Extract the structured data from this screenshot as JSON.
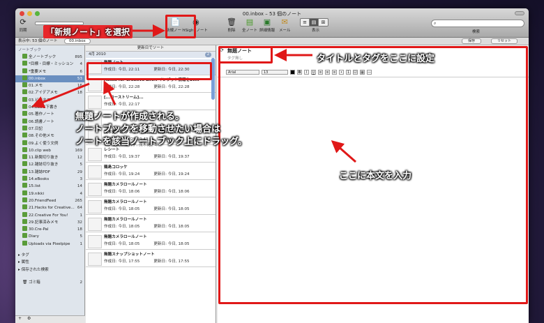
{
  "window": {
    "title": "00.inbox – 53 個のノート"
  },
  "toolbar": {
    "sync_label": "同期",
    "new_note_label": "新規ノート",
    "sight_note_label": "iSight ノート",
    "delete_label": "削除",
    "all_notes_label": "全ノート",
    "info_label": "詳細情報",
    "mail_label": "メール",
    "view_label": "表示",
    "search_label": "検索"
  },
  "subbar": {
    "showing_label": "表示中: 53 個のノート",
    "notebook_chip": "00.inbox",
    "save_label": "保存",
    "reset_label": "リセット"
  },
  "sidebar": {
    "heading": "ノートブック",
    "items": [
      {
        "label": "全ノートブック",
        "count": "895"
      },
      {
        "label": "*目標・目標・ミッション",
        "count": "4"
      },
      {
        "label": "*重要メモ",
        "count": "6"
      },
      {
        "label": "00.inbox",
        "count": "53"
      },
      {
        "label": "01.メモ",
        "count": "16"
      },
      {
        "label": "02.アイデアメモ",
        "count": "18"
      },
      {
        "label": "03.ビジネス",
        "count": ""
      },
      {
        "label": "04.BLOG下書き",
        "count": ""
      },
      {
        "label": "05.著作ノート",
        "count": ""
      },
      {
        "label": "06.読書ノート",
        "count": ""
      },
      {
        "label": "07.日記",
        "count": ""
      },
      {
        "label": "08.その他メモ",
        "count": ""
      },
      {
        "label": "09.よく使う文例",
        "count": ""
      },
      {
        "label": "10.clip web",
        "count": "169"
      },
      {
        "label": "11.新聞切り抜き",
        "count": "12"
      },
      {
        "label": "12.雑誌切り抜き",
        "count": "5"
      },
      {
        "label": "13.雑誌PDF",
        "count": "29"
      },
      {
        "label": "14.eBooks",
        "count": "3"
      },
      {
        "label": "15.list",
        "count": "14"
      },
      {
        "label": "19.nikki",
        "count": "4"
      },
      {
        "label": "20.FriendFeed",
        "count": "265"
      },
      {
        "label": "21.Hacks for Creative...",
        "count": "64"
      },
      {
        "label": "22.Creative For You!",
        "count": "1"
      },
      {
        "label": "29.記事済みメモ",
        "count": "32"
      },
      {
        "label": "30.Cre-Pal",
        "count": "18"
      },
      {
        "label": "Diary",
        "count": "5"
      },
      {
        "label": "Uploads via Pixelpipe",
        "count": "1"
      }
    ],
    "groups": [
      "タグ",
      "属性",
      "保存された検索"
    ],
    "trash_label": "ゴミ箱",
    "trash_count": "2"
  },
  "notelist": {
    "sort_label": "更新日でソート",
    "date_group": "4月 2010",
    "date_badge": "2",
    "notes": [
      {
        "title": "無題ノート",
        "created": "作成日: 今日, 22:11",
        "updated": "更新日: 今日, 22:30",
        "tags": ""
      },
      {
        "title": "Hacks for Creative Life!: インプット情報をEv...",
        "created": "作成日: 今日, 22:28",
        "updated": "更新日: 今日, 22:28",
        "tags": ""
      },
      {
        "title": "[...コーストリーム]...",
        "created": "作成日: 今日, 22:17",
        "updated": "",
        "tags": ""
      },
      {
        "title": "",
        "created": "",
        "updated": "",
        "tags": ""
      },
      {
        "title": "茂木健一郎 クオリア日記: ○○は脳に良いですか？",
        "created": "作成日: 10/04/25 10:43",
        "updated": "更新日: 今日, 22:13",
        "tags": "タグ: 習慣, 脳科学, 茂木健一郎"
      },
      {
        "title": "レシート",
        "created": "作成日: 今日, 19:37",
        "updated": "更新日: 今日, 19:37",
        "tags": ""
      },
      {
        "title": "鶏島コロッケ",
        "created": "作成日: 今日, 19:24",
        "updated": "更新日: 今日, 19:24",
        "tags": ""
      },
      {
        "title": "無題カメラロールノート",
        "created": "作成日: 今日, 18:06",
        "updated": "更新日: 今日, 18:06",
        "tags": ""
      },
      {
        "title": "無題カメラロールノート",
        "created": "作成日: 今日, 18:05",
        "updated": "更新日: 今日, 18:05",
        "tags": ""
      },
      {
        "title": "無題カメラロールノート",
        "created": "作成日: 今日, 18:05",
        "updated": "更新日: 今日, 18:05",
        "tags": ""
      },
      {
        "title": "無題カメラロールノート",
        "created": "作成日: 今日, 18:05",
        "updated": "更新日: 今日, 18:05",
        "tags": ""
      },
      {
        "title": "無題スナップショットノート",
        "created": "作成日: 今日, 17:55",
        "updated": "更新日: 今日, 17:55",
        "tags": ""
      }
    ]
  },
  "editor": {
    "title": "無題ノート",
    "tag_placeholder": "タグ無し",
    "font": "Arial",
    "size": "13",
    "bold": "B",
    "italic": "I",
    "underline": "U"
  },
  "annotations": {
    "new_note": "「新規ノート」を選択",
    "title_tags": "タイトルとタグをここに設定",
    "created_line1": "無題ノートが作成される。",
    "created_line2": "ノートブックを移動させたい場合は",
    "created_line3": "ノートを該当ノートブック上にドラッグ。",
    "body": "ここに本文を入力"
  },
  "colors": {
    "annotation_red": "#e01818",
    "selection_blue": "#6a8fc0",
    "notebook_green": "#5a9c3a"
  }
}
